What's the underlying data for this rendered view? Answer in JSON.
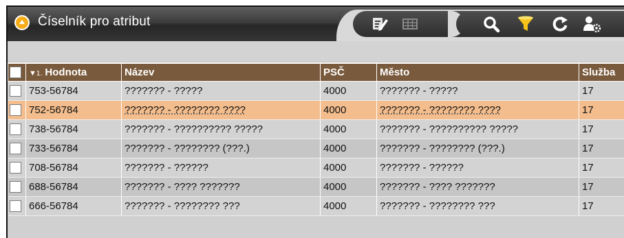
{
  "window": {
    "title": "Číselník pro atribut",
    "collapse_icon": "collapse-up-icon"
  },
  "toolbar": {
    "buttons": [
      {
        "name": "edit-icon",
        "label": "edit",
        "enabled": true
      },
      {
        "name": "table-icon",
        "label": "table",
        "enabled": false
      },
      {
        "name": "search-icon",
        "label": "search",
        "enabled": true
      },
      {
        "name": "filter-icon",
        "label": "filter",
        "enabled": true,
        "color": "#f7c31a"
      },
      {
        "name": "refresh-icon",
        "label": "refresh",
        "enabled": true
      },
      {
        "name": "user-settings-icon",
        "label": "user settings",
        "enabled": true
      }
    ]
  },
  "table": {
    "sort_indicator": "▼",
    "sort_order": "1.",
    "headers": [
      "Hodnota",
      "Název",
      "PSČ",
      "Město",
      "Služba"
    ],
    "rows": [
      {
        "hodnota": "753-56784",
        "nazev": "??????? - ?????",
        "psc": "4000",
        "mesto": "??????? - ?????",
        "sluzba": "17",
        "selected": false
      },
      {
        "hodnota": "752-56784",
        "nazev": "??????? - ???????? ????",
        "psc": "4000",
        "mesto": "??????? - ???????? ????",
        "sluzba": "17",
        "selected": true
      },
      {
        "hodnota": "738-56784",
        "nazev": "??????? - ?????????? ?????",
        "psc": "4000",
        "mesto": "??????? - ?????????? ?????",
        "sluzba": "17",
        "selected": false
      },
      {
        "hodnota": "733-56784",
        "nazev": "??????? - ???????? (???.)",
        "psc": "4000",
        "mesto": "??????? - ???????? (???.)",
        "sluzba": "17",
        "selected": false
      },
      {
        "hodnota": "708-56784",
        "nazev": "??????? - ??????",
        "psc": "4000",
        "mesto": "??????? - ??????",
        "sluzba": "17",
        "selected": false
      },
      {
        "hodnota": "688-56784",
        "nazev": "??????? - ???? ???????",
        "psc": "4000",
        "mesto": "??????? - ???? ???????",
        "sluzba": "17",
        "selected": false
      },
      {
        "hodnota": "666-56784",
        "nazev": "??????? - ???????? ???",
        "psc": "4000",
        "mesto": "??????? - ???????? ???",
        "sluzba": "17",
        "selected": false
      }
    ]
  },
  "colors": {
    "header_bg": "#7a5a3c",
    "selected_row": "#f3bd8d",
    "accent_orange": "#f7ad1a"
  }
}
